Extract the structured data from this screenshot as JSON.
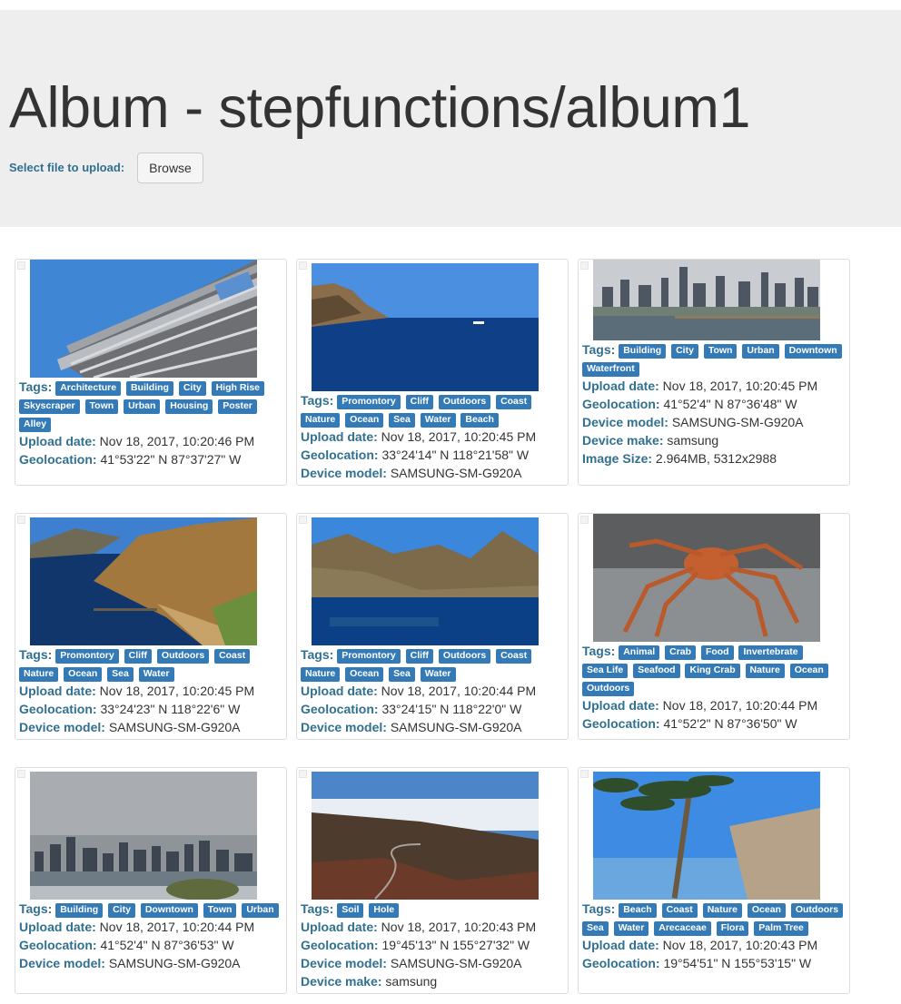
{
  "header": {
    "title": "Album - stepfunctions/album1",
    "upload_label": "Select file to upload:",
    "browse_label": "Browse"
  },
  "labels": {
    "tags": "Tags:",
    "upload_date": "Upload date:",
    "geolocation": "Geolocation:",
    "device_model": "Device model:",
    "device_make": "Device make:",
    "image_size": "Image Size:"
  },
  "photos": [
    {
      "tags": [
        "Architecture",
        "Building",
        "City",
        "High Rise",
        "Skyscraper",
        "Town",
        "Urban",
        "Housing",
        "Poster",
        "Alley"
      ],
      "upload_date": "Nov 18, 2017, 10:20:46 PM",
      "geolocation": "41°53'22\" N 87°37'27\" W"
    },
    {
      "tags": [
        "Promontory",
        "Cliff",
        "Outdoors",
        "Coast",
        "Nature",
        "Ocean",
        "Sea",
        "Water",
        "Beach"
      ],
      "upload_date": "Nov 18, 2017, 10:20:45 PM",
      "geolocation": "33°24'14\" N 118°21'58\" W",
      "device_model": "SAMSUNG-SM-G920A"
    },
    {
      "tags": [
        "Building",
        "City",
        "Town",
        "Urban",
        "Downtown",
        "Waterfront"
      ],
      "upload_date": "Nov 18, 2017, 10:20:45 PM",
      "geolocation": "41°52'4\" N 87°36'48\" W",
      "device_model": "SAMSUNG-SM-G920A",
      "device_make": "samsung",
      "image_size": "2.964MB, 5312x2988"
    },
    {
      "tags": [
        "Promontory",
        "Cliff",
        "Outdoors",
        "Coast",
        "Nature",
        "Ocean",
        "Sea",
        "Water"
      ],
      "upload_date": "Nov 18, 2017, 10:20:45 PM",
      "geolocation": "33°24'23\" N 118°22'6\" W",
      "device_model": "SAMSUNG-SM-G920A"
    },
    {
      "tags": [
        "Promontory",
        "Cliff",
        "Outdoors",
        "Coast",
        "Nature",
        "Ocean",
        "Sea",
        "Water"
      ],
      "upload_date": "Nov 18, 2017, 10:20:44 PM",
      "geolocation": "33°24'15\" N 118°22'0\" W",
      "device_model": "SAMSUNG-SM-G920A"
    },
    {
      "tags": [
        "Animal",
        "Crab",
        "Food",
        "Invertebrate",
        "Sea Life",
        "Seafood",
        "King Crab",
        "Nature",
        "Ocean",
        "Outdoors"
      ],
      "upload_date": "Nov 18, 2017, 10:20:44 PM",
      "geolocation": "41°52'2\" N 87°36'50\" W"
    },
    {
      "tags": [
        "Building",
        "City",
        "Downtown",
        "Town",
        "Urban"
      ],
      "upload_date": "Nov 18, 2017, 10:20:44 PM",
      "geolocation": "41°52'4\" N 87°36'53\" W",
      "device_model": "SAMSUNG-SM-G920A"
    },
    {
      "tags": [
        "Soil",
        "Hole"
      ],
      "upload_date": "Nov 18, 2017, 10:20:43 PM",
      "geolocation": "19°45'13\" N 155°27'32\" W",
      "device_model": "SAMSUNG-SM-G920A",
      "device_make": "samsung"
    },
    {
      "tags": [
        "Beach",
        "Coast",
        "Nature",
        "Ocean",
        "Outdoors",
        "Sea",
        "Water",
        "Arecaceae",
        "Flora",
        "Palm Tree"
      ],
      "upload_date": "Nov 18, 2017, 10:20:43 PM",
      "geolocation": "19°54'51\" N 155°53'15\" W"
    }
  ]
}
